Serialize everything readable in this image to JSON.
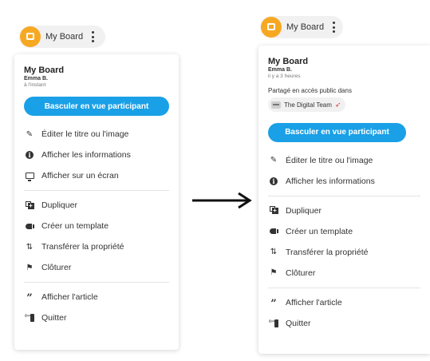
{
  "before": {
    "pill_title": "My Board",
    "board_title": "My Board",
    "owner": "Emma B.",
    "time": "à l'instant",
    "participant_button": "Basculer en vue participant",
    "menu": [
      {
        "icon": "pencil-icon",
        "label": "Éditer le titre ou l'image"
      },
      {
        "icon": "info-icon",
        "label": "Afficher les informations"
      },
      {
        "icon": "screen-icon",
        "label": "Afficher sur un écran"
      },
      {
        "icon": "duplicate-icon",
        "label": "Dupliquer"
      },
      {
        "icon": "template-icon",
        "label": "Créer un template"
      },
      {
        "icon": "transfer-icon",
        "label": "Transférer la propriété"
      },
      {
        "icon": "flag-icon",
        "label": "Clôturer"
      },
      {
        "icon": "quote-icon",
        "label": "Afficher l'article"
      },
      {
        "icon": "exit-icon",
        "label": "Quitter"
      }
    ]
  },
  "after": {
    "pill_title": "My Board",
    "board_title": "My Board",
    "owner": "Emma B.",
    "time": "il y a 3 heures",
    "shared_label": "Partagé en accès public dans",
    "team_name": "The Digital Team",
    "participant_button": "Basculer en vue participant",
    "menu": [
      {
        "icon": "pencil-icon",
        "label": "Éditer le titre ou l'image"
      },
      {
        "icon": "info-icon",
        "label": "Afficher les informations"
      },
      {
        "icon": "duplicate-icon",
        "label": "Dupliquer"
      },
      {
        "icon": "template-icon",
        "label": "Créer un template"
      },
      {
        "icon": "transfer-icon",
        "label": "Transférer la propriété"
      },
      {
        "icon": "flag-icon",
        "label": "Clôturer"
      },
      {
        "icon": "quote-icon",
        "label": "Afficher l'article"
      },
      {
        "icon": "exit-icon",
        "label": "Quitter"
      }
    ]
  },
  "colors": {
    "accent": "#1aa0e6",
    "logo": "#f7a823",
    "text": "#333333"
  }
}
